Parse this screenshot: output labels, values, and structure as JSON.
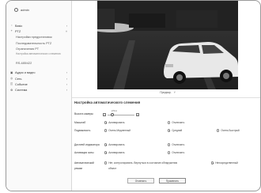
{
  "user": {
    "name": "admin"
  },
  "sidebar": {
    "items": [
      {
        "label": "Basic",
        "icon": "camera-icon"
      },
      {
        "label": "PTZ",
        "icon": "plus-icon"
      }
    ],
    "ptz_sub": [
      "Настройки предустановок",
      "Последовательность PTZ",
      "Ограничения PT",
      "Настройка автоматического слежения",
      "RS-485/422"
    ],
    "bottom_items": [
      {
        "label": "Аудио и видео",
        "icon": "video-icon"
      },
      {
        "label": "Сеть",
        "icon": "network-icon"
      },
      {
        "label": "Событие",
        "icon": "event-icon"
      },
      {
        "label": "Система",
        "icon": "gear-icon"
      }
    ]
  },
  "video": {
    "control_label": "Предвар."
  },
  "section": {
    "title": "Настройка автоматического слежения",
    "height": {
      "label": "Высота камеры",
      "value_text": "2.5 m"
    },
    "mode": {
      "label": "Масштаб",
      "opt_on": "Активировать",
      "opt_off": "Отключить"
    },
    "sensitivity": {
      "label": "Подвижность",
      "opt_1": "Очень Медленный",
      "opt_2": "Средний",
      "opt_3": "Очень Быстрый"
    },
    "indicator": {
      "label": "Дисплей индикатора",
      "opt_on": "Активировать",
      "opt_off": "Отключить"
    },
    "zone": {
      "label": "Активация зоны",
      "opt_on": "Активировать",
      "opt_off": "Отключить"
    },
    "auto_mode": {
      "label": "Автоматический",
      "label2": "режим",
      "opt_1": "Нет, контролировать. Вернуться в состояние обнаружения",
      "opt_2": "Непосредственный",
      "opt_sub": "объект"
    }
  },
  "buttons": {
    "cancel": "Отменить",
    "apply": "Применить"
  }
}
